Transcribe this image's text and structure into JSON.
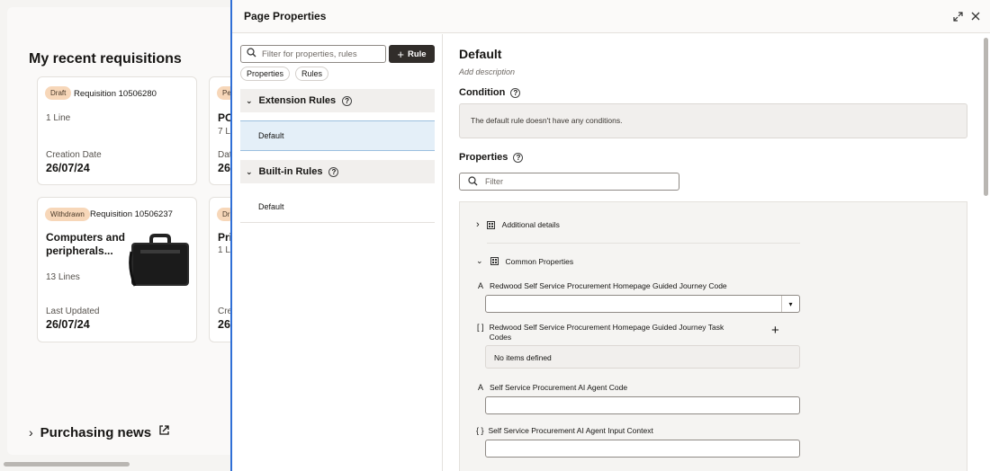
{
  "background": {
    "title": "My recent requisitions",
    "cards": [
      {
        "badge": "Draft",
        "number": "Requisition 10506280",
        "lines": "1 Line",
        "date_label": "Creation Date",
        "date": "26/07/24"
      },
      {
        "badge": "Pe",
        "name": "PO",
        "lines": "7 Li",
        "date_label": "Dat",
        "date": "26"
      },
      {
        "badge": "Withdrawn",
        "number": "Requisition 10506237",
        "name": "Computers and peripherals...",
        "lines": "13 Lines",
        "date_label": "Last Updated",
        "date": "26/07/24"
      },
      {
        "badge": "Dr",
        "name": "Pri",
        "lines": "1 Li",
        "date_label": "Cre",
        "date": "26"
      }
    ],
    "news": "Purchasing news"
  },
  "panel": {
    "title": "Page Properties",
    "filter_placeholder": "Filter for properties, rules",
    "rule_button": "Rule",
    "chips": [
      "Properties",
      "Rules"
    ],
    "sections": [
      {
        "title": "Extension Rules",
        "items": [
          "Default"
        ]
      },
      {
        "title": "Built-in Rules",
        "items": [
          "Default"
        ]
      }
    ],
    "detail": {
      "title": "Default",
      "description": "Add description",
      "condition_label": "Condition",
      "condition_text": "The default rule doesn't have any conditions.",
      "properties_label": "Properties",
      "properties_filter": "Filter",
      "groups": [
        "Additional details",
        "Common Properties"
      ],
      "fields": [
        {
          "icon": "A",
          "label": "Redwood Self Service Procurement Homepage Guided Journey Code"
        },
        {
          "icon": "[ ]",
          "label": "Redwood Self Service Procurement Homepage Guided Journey Task Codes",
          "empty": "No items defined"
        },
        {
          "icon": "A",
          "label": "Self Service Procurement AI Agent Code"
        },
        {
          "icon": "{ }",
          "label": "Self Service Procurement AI Agent Input Context"
        }
      ]
    }
  }
}
